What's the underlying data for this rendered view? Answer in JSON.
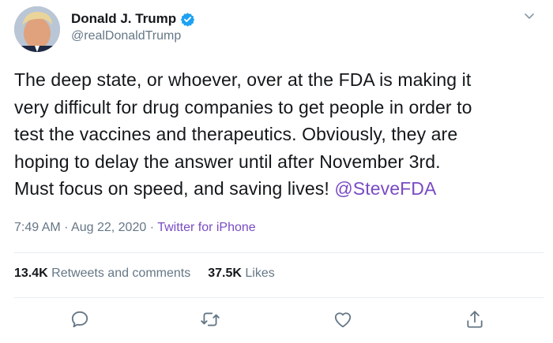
{
  "author": {
    "display_name": "Donald J. Trump",
    "handle": "@realDonaldTrump",
    "verified": true
  },
  "tweet": {
    "lines": [
      "The deep state, or whoever, over at the FDA is making it",
      "very difficult for drug companies to get people in order to",
      "test the vaccines and therapeutics. Obviously, they are",
      "hoping to delay the answer until after November 3rd.",
      "Must focus on speed, and saving lives! "
    ],
    "mention": "@SteveFDA"
  },
  "meta": {
    "time": "7:49 AM",
    "separator": " · ",
    "date": "Aug 22, 2020",
    "source": "Twitter for iPhone"
  },
  "stats": {
    "retweets_count": "13.4K",
    "retweets_label": " Retweets and comments",
    "likes_count": "37.5K",
    "likes_label": " Likes"
  },
  "colors": {
    "text": "#14171a",
    "secondary": "#657786",
    "accent": "#794bc4",
    "verified": "#1da1f2",
    "divider": "#e6ecf0"
  },
  "icons": {
    "verified": "verified-badge-icon",
    "caret": "chevron-down-icon",
    "reply": "reply-icon",
    "retweet": "retweet-icon",
    "like": "heart-icon",
    "share": "share-icon"
  }
}
